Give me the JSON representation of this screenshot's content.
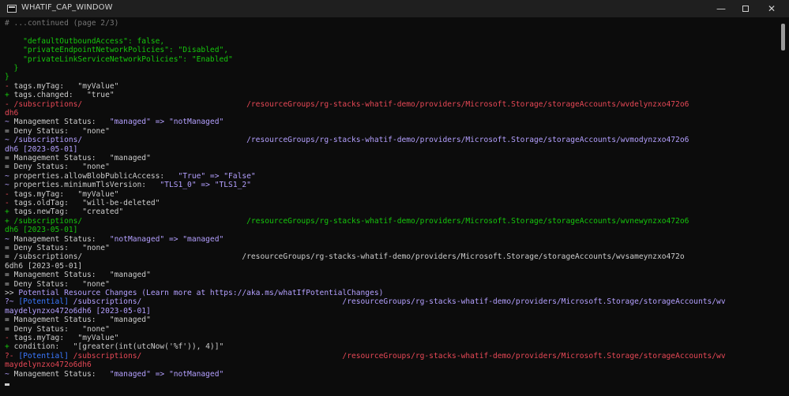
{
  "window": {
    "title": "WHATIF_CAP_WINDOW",
    "minimize_glyph": "—",
    "close_glyph": "✕",
    "icon": "terminal-icon"
  },
  "colors": {
    "background": "#0c0c0c",
    "text": "#cccccc",
    "green": "#16c60c",
    "red": "#e74856",
    "purple": "#b4a0ff",
    "blue": "#3b78ff",
    "gray": "#767676"
  },
  "lines": [
    {
      "segs": [
        {
          "t": "# ...continued (page 2/3)",
          "c": "gray"
        }
      ]
    },
    {
      "segs": [
        {
          "t": "",
          "c": "text"
        }
      ]
    },
    {
      "segs": [
        {
          "t": "    \"defaultOutboundAccess\": false,",
          "c": "green"
        }
      ]
    },
    {
      "segs": [
        {
          "t": "    \"privateEndpointNetworkPolicies\": \"Disabled\",",
          "c": "green"
        }
      ]
    },
    {
      "segs": [
        {
          "t": "    \"privateLinkServiceNetworkPolicies\": \"Enabled\"",
          "c": "green"
        }
      ]
    },
    {
      "segs": [
        {
          "t": "  }",
          "c": "green"
        }
      ]
    },
    {
      "segs": [
        {
          "t": "}",
          "c": "green"
        }
      ]
    },
    {
      "segs": [
        {
          "t": "- ",
          "c": "red"
        },
        {
          "t": "tags.myTag:   \"myValue\"",
          "c": "text"
        }
      ]
    },
    {
      "segs": [
        {
          "t": "+ ",
          "c": "green"
        },
        {
          "t": "tags.changed:   \"true\"",
          "c": "text"
        }
      ]
    },
    {
      "segs": [
        {
          "t": "- /subscriptions/                                    /resourceGroups/rg-stacks-whatif-demo/providers/Microsoft.Storage/storageAccounts/wvdelynzxo472o6",
          "c": "red"
        }
      ]
    },
    {
      "segs": [
        {
          "t": "dh6",
          "c": "red"
        }
      ]
    },
    {
      "segs": [
        {
          "t": "~ ",
          "c": "purple"
        },
        {
          "t": "Management Status:   ",
          "c": "text"
        },
        {
          "t": "\"managed\" => \"notManaged\"",
          "c": "purple"
        }
      ]
    },
    {
      "segs": [
        {
          "t": "= ",
          "c": "text"
        },
        {
          "t": "Deny Status:   \"none\"",
          "c": "text"
        }
      ]
    },
    {
      "segs": [
        {
          "t": "~ /subscriptions/                                    /resourceGroups/rg-stacks-whatif-demo/providers/Microsoft.Storage/storageAccounts/wvmodynzxo472o6",
          "c": "purple"
        }
      ]
    },
    {
      "segs": [
        {
          "t": "dh6 [2023-05-01]",
          "c": "purple"
        }
      ]
    },
    {
      "segs": [
        {
          "t": "= ",
          "c": "text"
        },
        {
          "t": "Management Status:   \"managed\"",
          "c": "text"
        }
      ]
    },
    {
      "segs": [
        {
          "t": "= ",
          "c": "text"
        },
        {
          "t": "Deny Status:   \"none\"",
          "c": "text"
        }
      ]
    },
    {
      "segs": [
        {
          "t": "~ ",
          "c": "purple"
        },
        {
          "t": "properties.allowBlobPublicAccess:   ",
          "c": "text"
        },
        {
          "t": "\"True\" => \"False\"",
          "c": "purple"
        }
      ]
    },
    {
      "segs": [
        {
          "t": "~ ",
          "c": "purple"
        },
        {
          "t": "properties.minimumTlsVersion:   ",
          "c": "text"
        },
        {
          "t": "\"TLS1_0\" => \"TLS1_2\"",
          "c": "purple"
        }
      ]
    },
    {
      "segs": [
        {
          "t": "- ",
          "c": "red"
        },
        {
          "t": "tags.myTag:   \"myValue\"",
          "c": "text"
        }
      ]
    },
    {
      "segs": [
        {
          "t": "- ",
          "c": "red"
        },
        {
          "t": "tags.oldTag:   \"will-be-deleted\"",
          "c": "text"
        }
      ]
    },
    {
      "segs": [
        {
          "t": "+ ",
          "c": "green"
        },
        {
          "t": "tags.newTag:   \"created\"",
          "c": "text"
        }
      ]
    },
    {
      "segs": [
        {
          "t": "+ /subscriptions/                                    /resourceGroups/rg-stacks-whatif-demo/providers/Microsoft.Storage/storageAccounts/wvnewynzxo472o6",
          "c": "green"
        }
      ]
    },
    {
      "segs": [
        {
          "t": "dh6 [2023-05-01]",
          "c": "green"
        }
      ]
    },
    {
      "segs": [
        {
          "t": "~ ",
          "c": "purple"
        },
        {
          "t": "Management Status:   ",
          "c": "text"
        },
        {
          "t": "\"notManaged\" => \"managed\"",
          "c": "purple"
        }
      ]
    },
    {
      "segs": [
        {
          "t": "= ",
          "c": "text"
        },
        {
          "t": "Deny Status:   \"none\"",
          "c": "text"
        }
      ]
    },
    {
      "segs": [
        {
          "t": "= /subscriptions/                                   /resourceGroups/rg-stacks-whatif-demo/providers/Microsoft.Storage/storageAccounts/wvsameynzxo472o",
          "c": "text"
        }
      ]
    },
    {
      "segs": [
        {
          "t": "6dh6 [2023-05-01]",
          "c": "text"
        }
      ]
    },
    {
      "segs": [
        {
          "t": "= ",
          "c": "text"
        },
        {
          "t": "Management Status:   \"managed\"",
          "c": "text"
        }
      ]
    },
    {
      "segs": [
        {
          "t": "= ",
          "c": "text"
        },
        {
          "t": "Deny Status:   \"none\"",
          "c": "text"
        }
      ]
    },
    {
      "segs": [
        {
          "t": ">> ",
          "c": "text"
        },
        {
          "t": "Potential Resource Changes (Learn more at https://aka.ms/whatIfPotentialChanges)",
          "c": "purple"
        }
      ]
    },
    {
      "segs": [
        {
          "t": "?~ ",
          "c": "purple"
        },
        {
          "t": "[Potential]",
          "c": "blue"
        },
        {
          "t": " /subscriptions/                                            /resourceGroups/rg-stacks-whatif-demo/providers/Microsoft.Storage/storageAccounts/wv",
          "c": "purple"
        }
      ]
    },
    {
      "segs": [
        {
          "t": "maydelynzxo472o6dh6 [2023-05-01]",
          "c": "purple"
        }
      ]
    },
    {
      "segs": [
        {
          "t": "= ",
          "c": "text"
        },
        {
          "t": "Management Status:   \"managed\"",
          "c": "text"
        }
      ]
    },
    {
      "segs": [
        {
          "t": "= ",
          "c": "text"
        },
        {
          "t": "Deny Status:   \"none\"",
          "c": "text"
        }
      ]
    },
    {
      "segs": [
        {
          "t": "- ",
          "c": "red"
        },
        {
          "t": "tags.myTag:   \"myValue\"",
          "c": "text"
        }
      ]
    },
    {
      "segs": [
        {
          "t": "+ ",
          "c": "green"
        },
        {
          "t": "condition:   \"[greater(int(utcNow('%f')), 4)]\"",
          "c": "text"
        }
      ]
    },
    {
      "segs": [
        {
          "t": "?- ",
          "c": "red"
        },
        {
          "t": "[Potential]",
          "c": "blue"
        },
        {
          "t": " /subscriptions/                                            /resourceGroups/rg-stacks-whatif-demo/providers/Microsoft.Storage/storageAccounts/wv",
          "c": "red"
        }
      ]
    },
    {
      "segs": [
        {
          "t": "maydelynzxo472o6dh6",
          "c": "red"
        }
      ]
    },
    {
      "segs": [
        {
          "t": "~ ",
          "c": "purple"
        },
        {
          "t": "Management Status:   ",
          "c": "text"
        },
        {
          "t": "\"managed\" => \"notManaged\"",
          "c": "purple"
        }
      ]
    }
  ]
}
